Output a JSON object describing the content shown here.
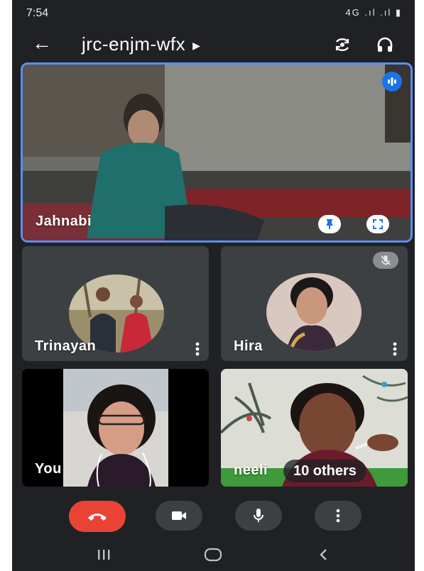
{
  "status_bar": {
    "time": "7:54",
    "indicators": "4G .ıl .ıl ▮"
  },
  "header": {
    "meeting_code": "jrc-enjm-wfx",
    "back_icon": "arrow-back-icon",
    "switch_camera_icon": "switch-camera-icon",
    "audio_output_icon": "headphones-icon"
  },
  "tiles": {
    "main": {
      "name": "Jahnabi",
      "pin_icon": "pin-icon",
      "fullscreen_icon": "fullscreen-icon",
      "speaking_icon": "speaking-indicator-icon"
    },
    "trinayan": {
      "name": "Trinayan"
    },
    "hira": {
      "name": "Hira",
      "muted_icon": "mic-off-icon"
    },
    "self": {
      "name": "You"
    },
    "neeli": {
      "name": "neeli",
      "others_label": "10 others"
    }
  },
  "controls": {
    "end_call_icon": "end-call-icon",
    "camera_icon": "camera-icon",
    "mic_icon": "mic-icon",
    "more_icon": "more-vert-icon"
  },
  "nav": {
    "recents_icon": "recents-icon",
    "home_icon": "home-icon",
    "back_icon": "back-icon"
  },
  "colors": {
    "background": "#202124",
    "tile": "#3c4043",
    "active_border": "#5b8ef0",
    "end_call": "#ea4335",
    "control_bg": "#3c4043"
  }
}
